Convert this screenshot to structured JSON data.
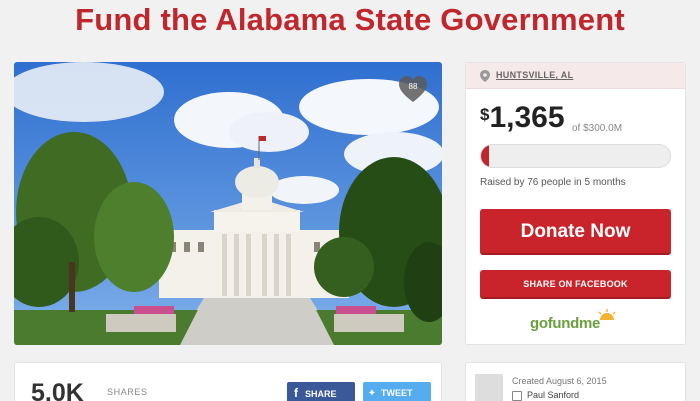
{
  "page": {
    "title": "Fund the Alabama State Government"
  },
  "photo": {
    "heart_count": "88"
  },
  "campaign": {
    "location": "HUNTSVILLE, AL",
    "currency_symbol": "$",
    "raised_amount": "1,365",
    "goal_text": "of $300.0M",
    "progress_fraction": 0.0015,
    "raised_by": "Raised by 76 people in 5 months",
    "donate_label": "Donate Now",
    "share_facebook_label": "SHARE ON FACEBOOK",
    "logo_text": "gofundme"
  },
  "shares": {
    "count": "5.0K",
    "label": "SHARES",
    "share_label": "SHARE",
    "tweet_label": "TWEET"
  },
  "organizer": {
    "created": "Created August 6, 2015",
    "name": "Paul Sanford"
  },
  "colors": {
    "brand_red": "#c9242b",
    "facebook_blue": "#3b5998",
    "twitter_blue": "#55acee",
    "gfm_green": "#6a9f3e"
  },
  "icons": {
    "heart": "heart-icon",
    "pin": "map-pin-icon",
    "facebook": "facebook-icon",
    "twitter": "twitter-icon",
    "person": "person-icon"
  }
}
